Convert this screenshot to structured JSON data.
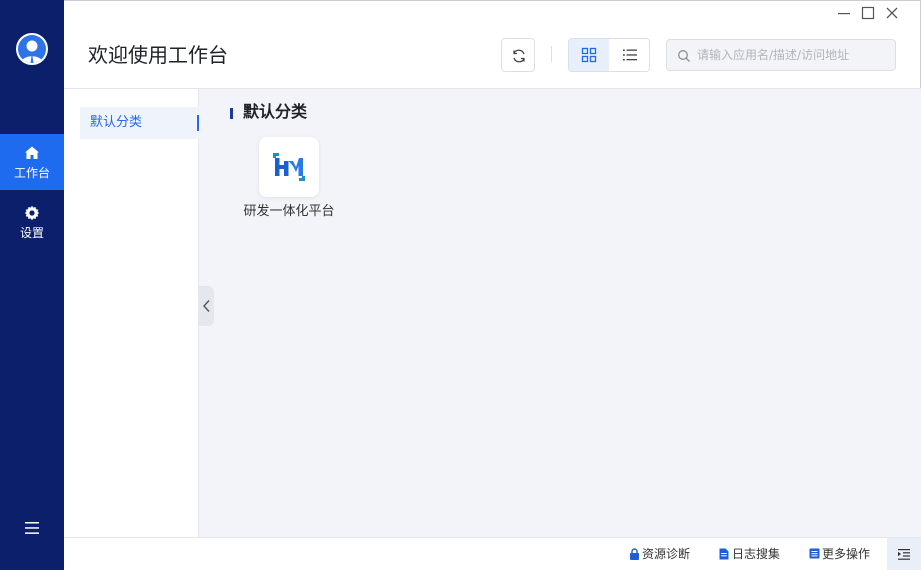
{
  "header": {
    "title": "欢迎使用工作台",
    "search_placeholder": "请输入应用名/描述/访问地址"
  },
  "nav": {
    "items": [
      {
        "label": "工作台",
        "icon": "home-icon",
        "active": true
      },
      {
        "label": "设置",
        "icon": "gear-icon",
        "active": false
      }
    ],
    "menu_icon": "hamburger-menu-icon"
  },
  "categories": {
    "items": [
      {
        "label": "默认分类",
        "selected": true
      }
    ]
  },
  "section": {
    "title": "默认分类",
    "apps": [
      {
        "name": "研发一体化平台",
        "icon": "hm-logo-icon"
      }
    ]
  },
  "footer": {
    "resource_diagnosis": "资源诊断",
    "log_collection": "日志搜集",
    "more_actions": "更多操作"
  },
  "colors": {
    "nav_bg": "#0b1f6b",
    "accent": "#1f6bf0",
    "main_bg": "#f2f4f9"
  }
}
